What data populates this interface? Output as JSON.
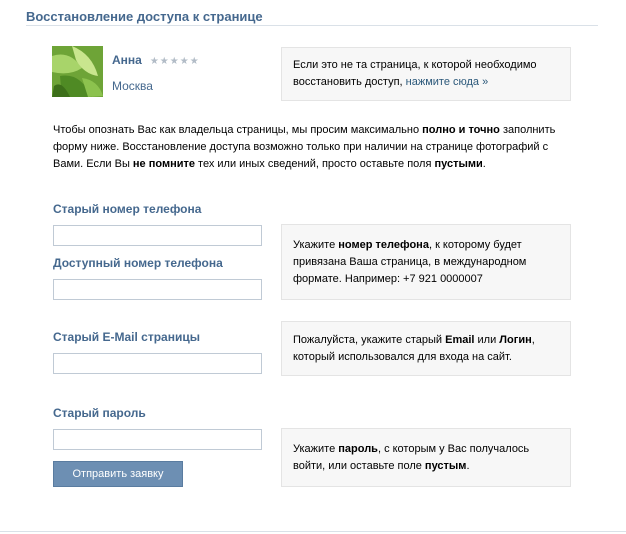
{
  "page": {
    "title": "Восстановление доступа к странице"
  },
  "profile": {
    "name": "Анна",
    "stars": "★★★★★",
    "city": "Москва",
    "avatar_icon": "leaf-avatar-photo"
  },
  "not_your_page": {
    "text": "Если это не та страница, к которой необходимо восстановить доступ,",
    "link": "нажмите сюда »"
  },
  "intro": {
    "p1": "Чтобы опознать Вас как владельца страницы, мы просим максимально ",
    "b1": "полно и точно",
    "p2": " заполнить форму ниже. Восстановление доступа возможно только при наличии на странице фотографий с Вами. Если Вы ",
    "b2": "не помните",
    "p3": " тех или иных сведений, просто оставьте поля ",
    "b3": "пустыми",
    "p4": "."
  },
  "form": {
    "old_phone_label": "Старый номер телефона",
    "available_phone_label": "Доступный номер телефона",
    "old_email_label": "Старый E-Mail страницы",
    "old_password_label": "Старый пароль",
    "submit_label": "Отправить заявку",
    "old_phone_value": "",
    "available_phone_value": "",
    "old_email_value": "",
    "old_password_value": ""
  },
  "hints": {
    "phone": {
      "t1": "Укажите ",
      "b1": "номер телефона",
      "t2": ", к которому будет привязана Ваша страница, в международном формате. Например: +7 921 0000007"
    },
    "email": {
      "t1": "Пожалуйста, укажите старый ",
      "b1": "Email",
      "t2": " или ",
      "b2": "Логин",
      "t3": ", который использовался для входа на сайт."
    },
    "password": {
      "t1": "Укажите ",
      "b1": "пароль",
      "t2": ", с которым у Вас получалось войти, или оставьте поле ",
      "b2": "пустым",
      "t3": "."
    }
  },
  "colors": {
    "accent": "#45688e",
    "button": "#6d8fb3",
    "box_bg": "#f7f7f7"
  }
}
